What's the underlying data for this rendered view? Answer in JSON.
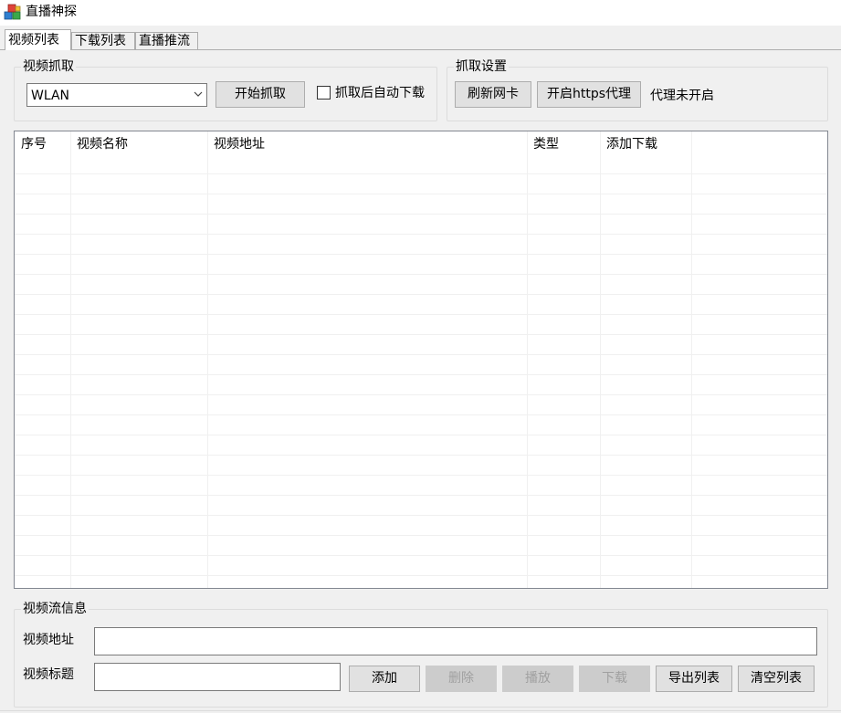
{
  "window": {
    "title": "直播神探",
    "icon": "app-cubes-icon"
  },
  "tabs": [
    {
      "label": "视频列表",
      "active": true
    },
    {
      "label": "下载列表",
      "active": false
    },
    {
      "label": "直播推流",
      "active": false
    }
  ],
  "capture": {
    "group_label": "视频抓取",
    "adapter_value": "WLAN",
    "start_button": "开始抓取",
    "auto_download_label": "抓取后自动下载",
    "auto_download_checked": false
  },
  "settings": {
    "group_label": "抓取设置",
    "refresh_button": "刷新网卡",
    "https_proxy_button": "开启https代理",
    "proxy_status": "代理未开启"
  },
  "table": {
    "columns": [
      "序号",
      "视频名称",
      "视频地址",
      "类型",
      "添加下载"
    ],
    "rows": []
  },
  "stream_info": {
    "group_label": "视频流信息",
    "url_label": "视频地址",
    "url_value": "",
    "title_label": "视频标题",
    "title_value": "",
    "buttons": {
      "add": "添加",
      "delete": "删除",
      "play": "播放",
      "download": "下载",
      "export": "导出列表",
      "clear": "清空列表"
    }
  }
}
